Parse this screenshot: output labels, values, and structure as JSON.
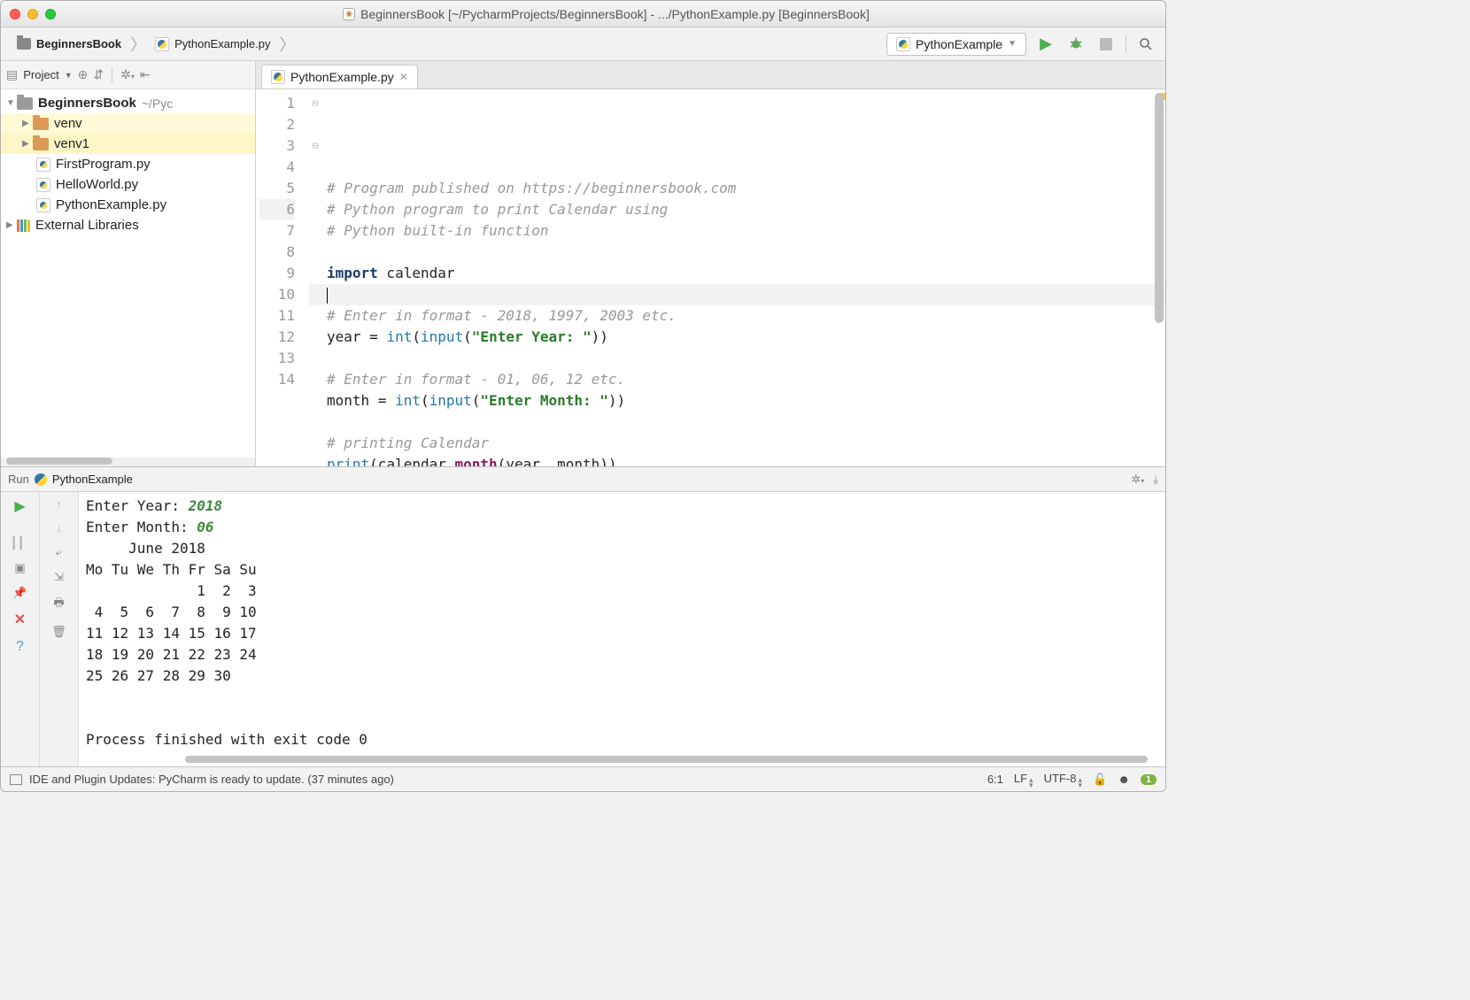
{
  "titlebar": {
    "title": "BeginnersBook [~/PycharmProjects/BeginnersBook] - .../PythonExample.py [BeginnersBook]"
  },
  "breadcrumb": {
    "project": "BeginnersBook",
    "file": "PythonExample.py"
  },
  "runconfig": {
    "name": "PythonExample"
  },
  "sidebar": {
    "toolLabel": "Project",
    "root": "BeginnersBook",
    "rootPath": "~/Pyc",
    "items": [
      "venv",
      "venv1",
      "FirstProgram.py",
      "HelloWorld.py",
      "PythonExample.py"
    ],
    "external": "External Libraries"
  },
  "tab": {
    "name": "PythonExample.py"
  },
  "code": {
    "lines": [
      {
        "t": "comment",
        "text": "# Program published on https://beginnersbook.com"
      },
      {
        "t": "comment",
        "text": "# Python program to print Calendar using"
      },
      {
        "t": "comment",
        "text": "# Python built-in function"
      },
      {
        "t": "blank",
        "text": ""
      },
      {
        "t": "import",
        "kw": "import",
        "mod": " calendar"
      },
      {
        "t": "cursor",
        "text": ""
      },
      {
        "t": "comment",
        "text": "# Enter in format - 2018, 1997, 2003 etc."
      },
      {
        "t": "assign_input",
        "pre": "year = ",
        "fn1": "int",
        "fn2": "input",
        "str": "\"Enter Year: \"",
        "post": ")) "
      },
      {
        "t": "blank",
        "text": ""
      },
      {
        "t": "comment",
        "text": "# Enter in format - 01, 06, 12 etc."
      },
      {
        "t": "assign_input",
        "pre": "month = ",
        "fn1": "int",
        "fn2": "input",
        "str": "\"Enter Month: \"",
        "post": ")) "
      },
      {
        "t": "blank",
        "text": ""
      },
      {
        "t": "comment",
        "text": "# printing Calendar"
      },
      {
        "t": "print",
        "fn": "print",
        "args1": "(calendar.",
        "method": "month",
        "args2": "(year, month))"
      }
    ]
  },
  "run": {
    "label": "Run",
    "name": "PythonExample",
    "output": {
      "p1": "Enter Year: ",
      "v1": "2018",
      "p2": "Enter Month: ",
      "v2": "06",
      "cal": "     June 2018\nMo Tu We Th Fr Sa Su\n             1  2  3\n 4  5  6  7  8  9 10\n11 12 13 14 15 16 17\n18 19 20 21 22 23 24\n25 26 27 28 29 30",
      "exit": "Process finished with exit code 0"
    }
  },
  "status": {
    "message": "IDE and Plugin Updates: PyCharm is ready to update. (37 minutes ago)",
    "pos": "6:1",
    "le": "LF",
    "enc": "UTF-8",
    "badge": "1"
  }
}
